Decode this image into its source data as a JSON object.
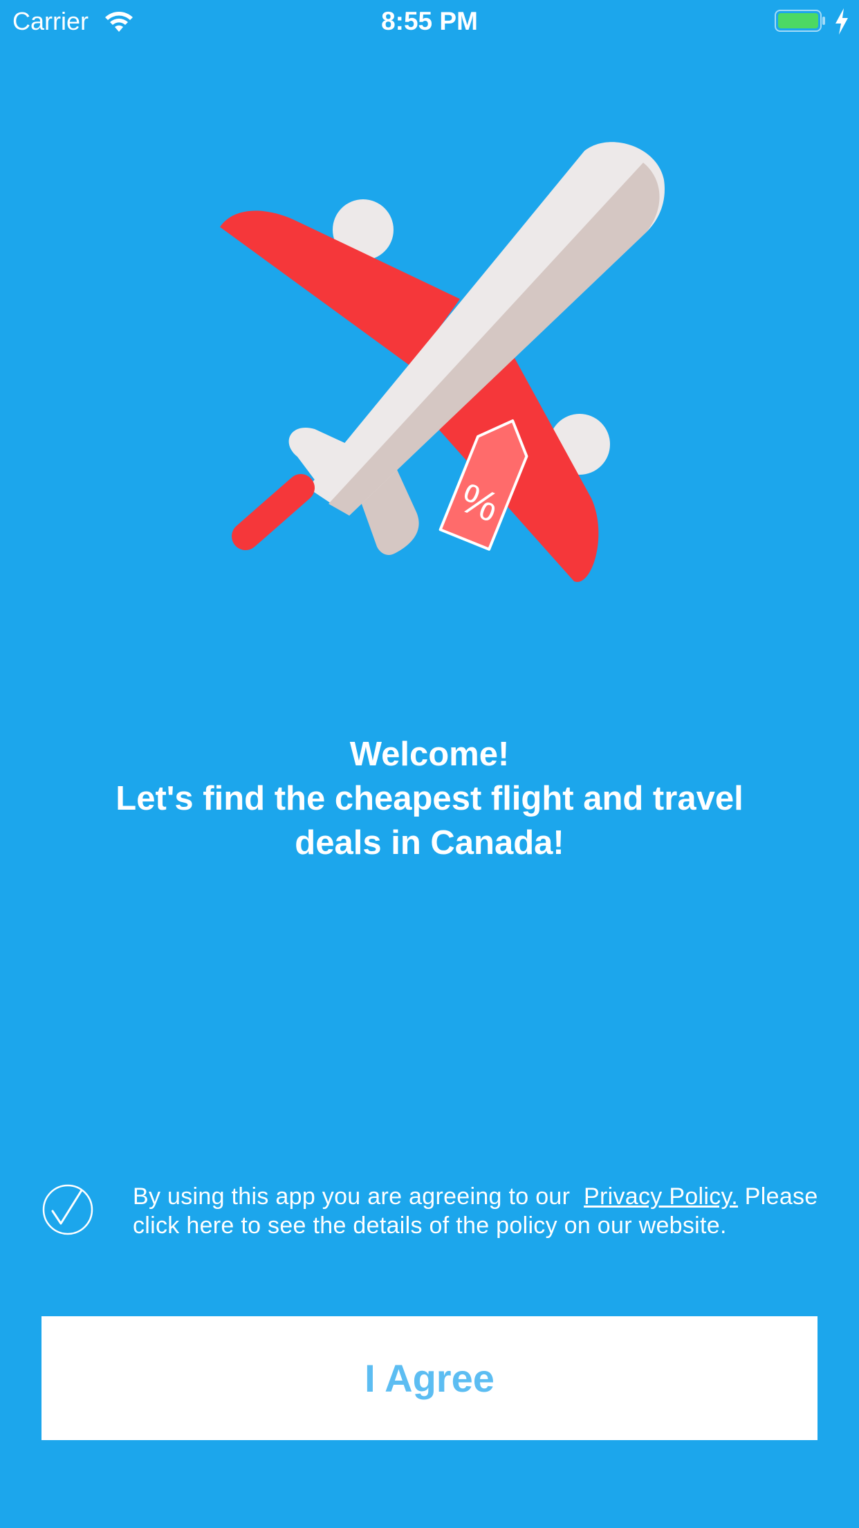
{
  "status_bar": {
    "carrier": "Carrier",
    "time": "8:55 PM"
  },
  "hero": {
    "icon": "airplane-discount-icon",
    "tag_text": "%"
  },
  "welcome": {
    "line1": "Welcome!",
    "line2": "Let's find the cheapest flight and travel",
    "line3": "deals in Canada!"
  },
  "consent": {
    "checked": true,
    "text_before": "By using this app you are agreeing to our",
    "link_text": "Privacy Policy.",
    "text_after": "Please click here to see the details of the policy on our website."
  },
  "agree_button": {
    "label": "I Agree"
  },
  "colors": {
    "background": "#1ca6ec",
    "button_text": "#5cbdf2",
    "plane_red": "#f5373a",
    "plane_body": "#ede9e9",
    "plane_shadow": "#d5c7c3",
    "tag": "#ff6b6b",
    "battery": "#4cd964"
  }
}
